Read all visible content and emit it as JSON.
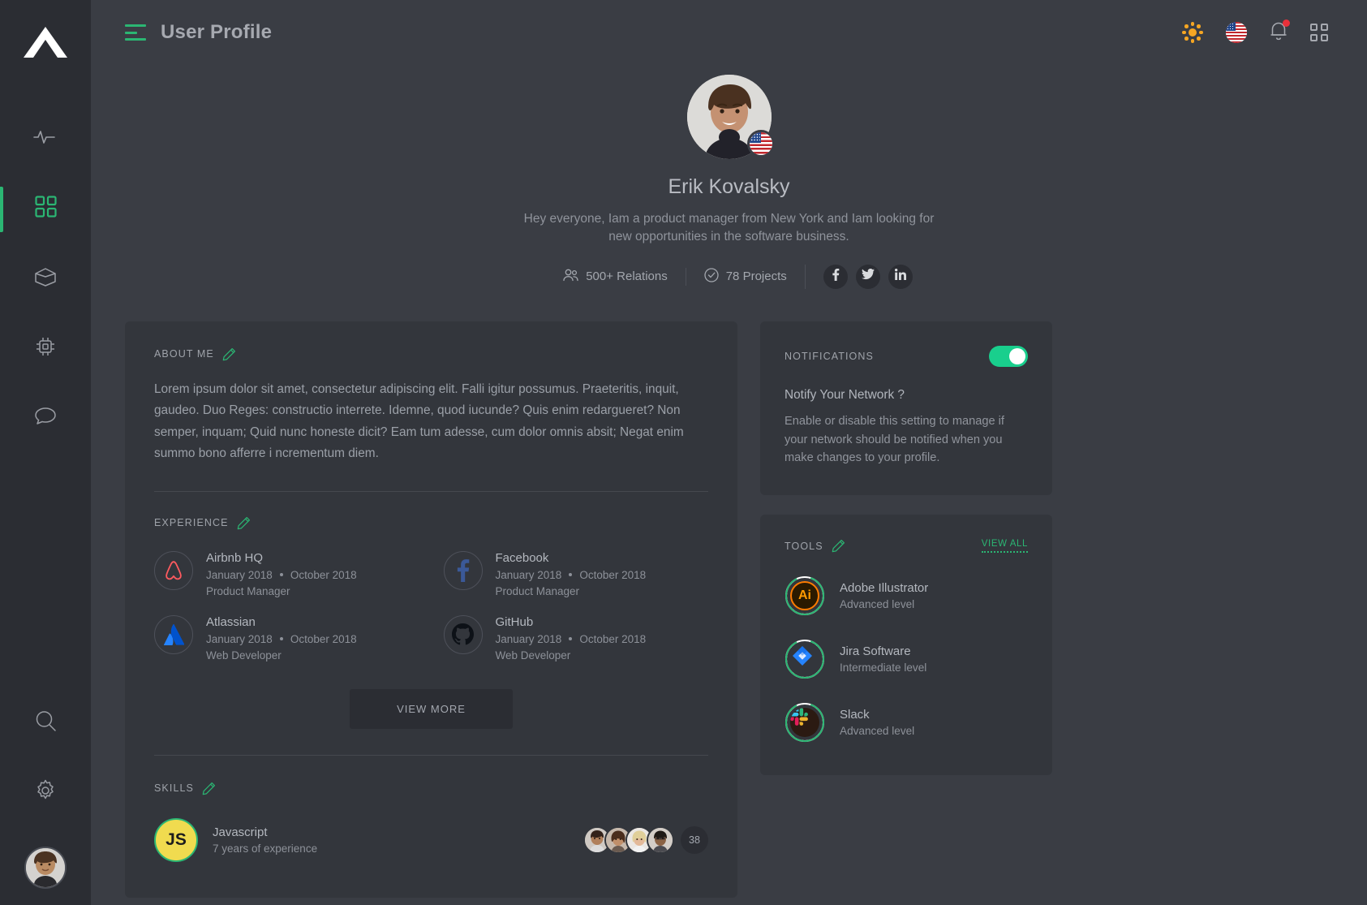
{
  "colors": {
    "accent_green": "#2bb673",
    "toggle_on": "#19cf8d",
    "bg_app": "#3a3d44",
    "bg_rail": "#2b2d33",
    "bg_card": "#33363c",
    "notification_dot": "#e8303a",
    "sun_icon": "#f5a623",
    "js_badge": "#f0db4f"
  },
  "rail": {
    "logo": "triangle-logo",
    "items": [
      {
        "name": "activity",
        "icon": "activity-pulse-icon",
        "active": false
      },
      {
        "name": "dashboard",
        "icon": "grid-squares-icon",
        "active": true
      },
      {
        "name": "packages",
        "icon": "cube-box-icon",
        "active": false
      },
      {
        "name": "components",
        "icon": "chip-processor-icon",
        "active": false
      },
      {
        "name": "messages",
        "icon": "chat-bubble-icon",
        "active": false
      }
    ],
    "bottom_items": [
      {
        "name": "search",
        "icon": "search-icon"
      },
      {
        "name": "settings",
        "icon": "gear-icon"
      }
    ],
    "avatar": "user-avatar"
  },
  "header": {
    "menu_icon": "hamburger-menu-icon",
    "title": "User Profile",
    "actions": [
      {
        "name": "theme-toggle",
        "icon": "sun-icon"
      },
      {
        "name": "language",
        "icon": "us-flag-icon"
      },
      {
        "name": "notifications",
        "icon": "bell-icon",
        "has_badge": true
      },
      {
        "name": "apps",
        "icon": "grid-apps-icon"
      }
    ]
  },
  "profile": {
    "avatar": "profile-photo",
    "country_flag": "us-flag-icon",
    "name": "Erik Kovalsky",
    "bio": "Hey everyone,  Iam a product manager from New York and Iam looking for new opportunities in the software business.",
    "stats": [
      {
        "icon": "people-icon",
        "label": "500+ Relations"
      },
      {
        "icon": "check-circle-icon",
        "label": "78 Projects"
      }
    ],
    "socials": [
      {
        "name": "facebook",
        "icon": "facebook-icon"
      },
      {
        "name": "twitter",
        "icon": "twitter-icon"
      },
      {
        "name": "linkedin",
        "icon": "linkedin-icon"
      }
    ]
  },
  "about": {
    "title": "ABOUT ME",
    "edit_icon": "pencil-edit-icon",
    "text": "Lorem ipsum dolor sit amet, consectetur adipiscing elit. Falli igitur possumus. Praeteritis, inquit, gaudeo. Duo Reges: constructio interrete. Idemne, quod iucunde? Quis enim redargueret? Non semper, inquam; Quid nunc honeste dicit? Eam tum adesse, cum dolor omnis absit; Negat enim summo bono afferre i ncrementum diem."
  },
  "experience": {
    "title": "EXPERIENCE",
    "edit_icon": "pencil-edit-icon",
    "items": [
      {
        "logo": "airbnb-icon",
        "company": "Airbnb HQ",
        "start": "January 2018",
        "end": "October 2018",
        "role": "Product Manager"
      },
      {
        "logo": "facebook-icon",
        "company": "Facebook",
        "start": "January 2018",
        "end": "October 2018",
        "role": "Product Manager"
      },
      {
        "logo": "atlassian-icon",
        "company": "Atlassian",
        "start": "January 2018",
        "end": "October 2018",
        "role": "Web Developer"
      },
      {
        "logo": "github-icon",
        "company": "GitHub",
        "start": "January 2018",
        "end": "October 2018",
        "role": "Web Developer"
      }
    ],
    "view_more_label": "VIEW MORE"
  },
  "skills": {
    "title": "SKILLS",
    "edit_icon": "pencil-edit-icon",
    "items": [
      {
        "badge": "JS",
        "name": "Javascript",
        "detail": "7 years of experience",
        "people_avatars": [
          "avatar-1",
          "avatar-2",
          "avatar-3",
          "avatar-4"
        ],
        "extra_count": "38"
      }
    ]
  },
  "notifications_card": {
    "title": "NOTIFICATIONS",
    "toggle_on": true,
    "question": "Notify Your Network ?",
    "description": "Enable or disable this setting to manage if your network should be notified when you make changes to your profile."
  },
  "tools_card": {
    "title": "TOOLS",
    "edit_icon": "pencil-edit-icon",
    "view_all_label": "VIEW ALL",
    "items": [
      {
        "icon": "adobe-illustrator-icon",
        "name": "Adobe Illustrator",
        "level": "Advanced level",
        "progress": 88
      },
      {
        "icon": "jira-software-icon",
        "name": "Jira Software",
        "level": "Intermediate level",
        "progress": 88
      },
      {
        "icon": "slack-icon",
        "name": "Slack",
        "level": "Advanced level",
        "progress": 88
      }
    ]
  }
}
